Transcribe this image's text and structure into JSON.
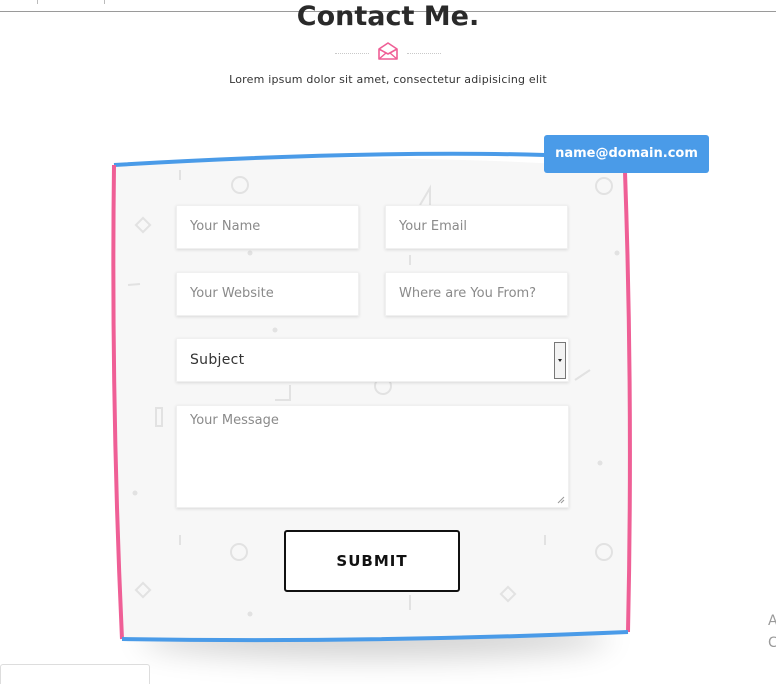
{
  "header": {
    "title": "Contact Me.",
    "subtitle": "Lorem ipsum dolor sit amet, consectetur adipisicing elit"
  },
  "email_badge": "name@domain.com",
  "form": {
    "name_placeholder": "Your Name",
    "email_placeholder": "Your Email",
    "website_placeholder": "Your Website",
    "from_placeholder": "Where are You From?",
    "subject_selected": "Subject",
    "message_placeholder": "Your Message",
    "submit_label": "SUBMIT"
  },
  "side_text": [
    "A",
    "C"
  ],
  "colors": {
    "accent_blue": "#4a9be8",
    "accent_pink": "#ef5f96",
    "card_bg": "#f7f7f7"
  },
  "icons": {
    "divider_icon": "envelope-icon"
  }
}
